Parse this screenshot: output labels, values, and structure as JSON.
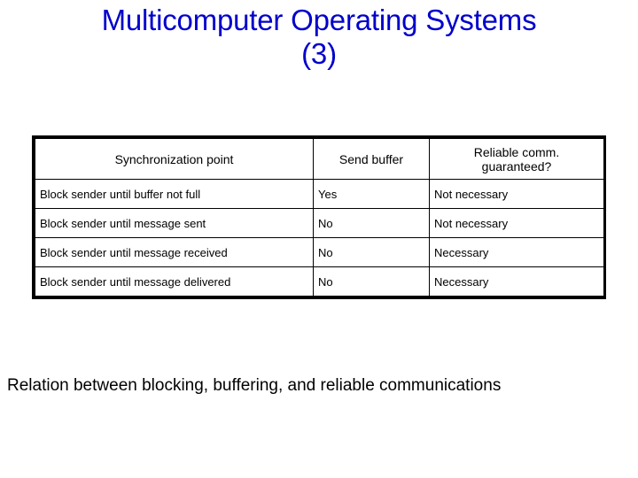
{
  "slide": {
    "title": "Multicomputer Operating Systems\n(3)",
    "title_color": "#0000CC",
    "caption": "Relation between blocking, buffering, and reliable communications"
  },
  "table": {
    "border_color": "#000000",
    "headers": {
      "col1": "Synchronization point",
      "col2": "Send buffer",
      "col3_line1": "Reliable comm.",
      "col3_line2": "guaranteed?"
    },
    "rows": [
      {
        "synchronization_point": "Block sender until buffer not full",
        "send_buffer": "Yes",
        "reliable_comm_guaranteed": "Not necessary"
      },
      {
        "synchronization_point": "Block sender until message sent",
        "send_buffer": "No",
        "reliable_comm_guaranteed": "Not necessary"
      },
      {
        "synchronization_point": "Block sender until message received",
        "send_buffer": "No",
        "reliable_comm_guaranteed": "Necessary"
      },
      {
        "synchronization_point": "Block sender until message delivered",
        "send_buffer": "No",
        "reliable_comm_guaranteed": "Necessary"
      }
    ]
  }
}
